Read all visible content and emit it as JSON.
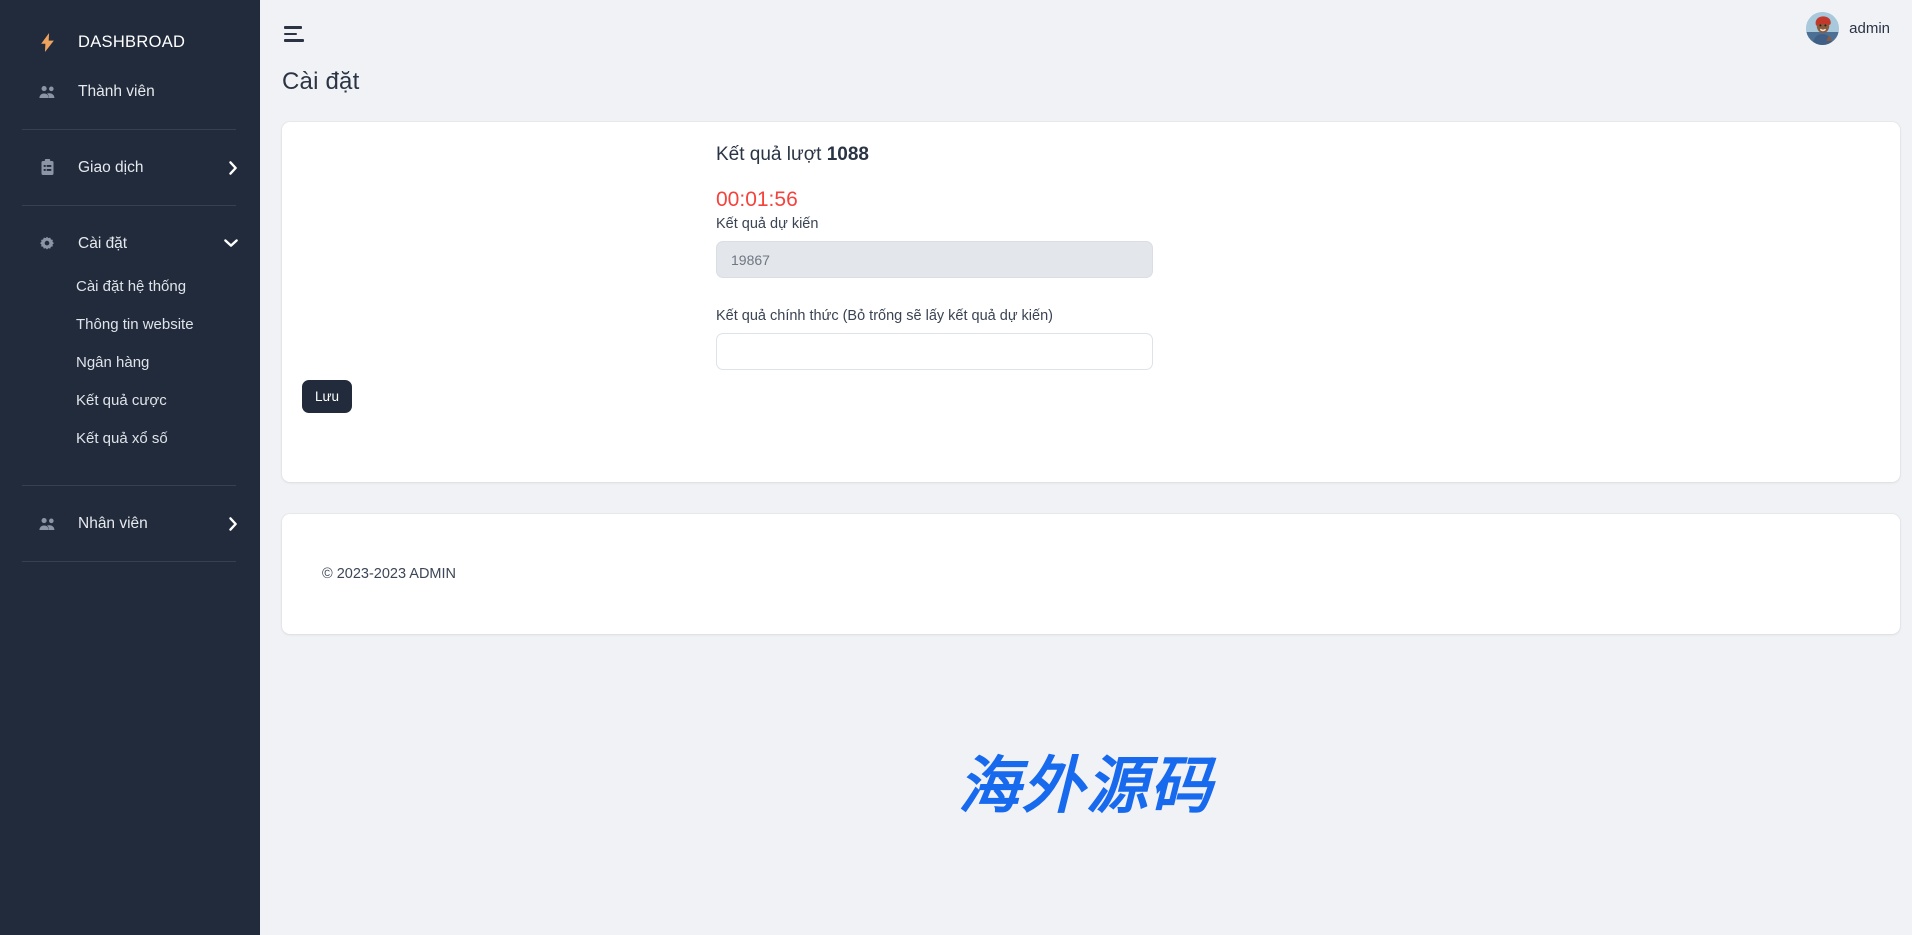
{
  "sidebar": {
    "brand": {
      "label": "DASHBROAD",
      "icon": "lightning-bolt-icon"
    },
    "items": [
      {
        "label": "Thành viên",
        "icon": "users-icon",
        "chevron": ""
      },
      {
        "label": "Giao dịch",
        "icon": "clipboard-list-icon",
        "chevron": "right"
      },
      {
        "label": "Cài đặt",
        "icon": "gear-icon",
        "chevron": "down"
      },
      {
        "label": "Nhân viên",
        "icon": "users-icon",
        "chevron": "right"
      }
    ],
    "settings_subitems": [
      {
        "label": "Cài đặt hệ thống"
      },
      {
        "label": "Thông tin website"
      },
      {
        "label": "Ngân hàng"
      },
      {
        "label": "Kết quả cược"
      },
      {
        "label": "Kết quả xổ số"
      }
    ]
  },
  "topbar": {
    "menu_toggle_icon": "hamburger-icon",
    "username": "admin",
    "avatar_icon": "user-avatar"
  },
  "page": {
    "title": "Cài đặt"
  },
  "form": {
    "result_title_prefix": "Kết quả lượt ",
    "result_round": "1088",
    "timer": "00:01:56",
    "expected_label": "Kết quả dự kiến",
    "expected_value": "19867",
    "official_label": "Kết quả chính thức (Bỏ trống sẽ lấy kết quả dự kiến)",
    "official_value": "",
    "official_placeholder": "",
    "save_label": "Lưu"
  },
  "footer": {
    "copyright": "© 2023-2023 ADMIN"
  },
  "watermark": {
    "text": "海外源码",
    "color": "#1769ee"
  },
  "colors": {
    "sidebar_bg": "#212b3b",
    "page_bg": "#f1f2f5",
    "accent_brand": "#efa35c",
    "timer_red": "#f4433c",
    "button_dark": "#212b3b"
  }
}
